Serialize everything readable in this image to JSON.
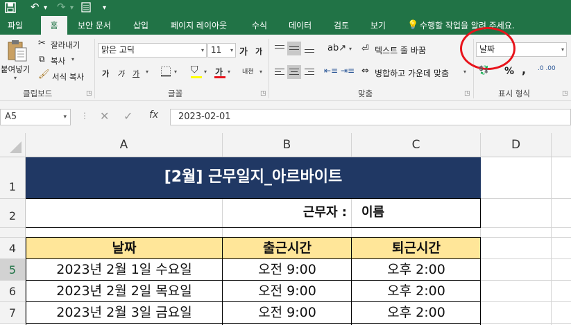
{
  "tabs": [
    "파일",
    "홈",
    "보안 문서",
    "삽입",
    "페이지 레이아웃",
    "수식",
    "데이터",
    "검토",
    "보기"
  ],
  "tell_me": "수행할 작업을 알려 주세요.",
  "clipboard": {
    "paste": "붙여넣기",
    "cut": "잘라내기",
    "copy": "복사",
    "format_painter": "서식 복사",
    "group": "클립보드"
  },
  "font": {
    "name": "맑은 고딕",
    "size": "11",
    "grow": "가",
    "shrink": "가",
    "bold": "가",
    "italic": "가",
    "underline": "가",
    "color_a": "가",
    "phonetic": "내천",
    "group": "글꼴"
  },
  "alignment": {
    "wrap": "텍스트 줄 바꿈",
    "merge": "병합하고 가운데 맞춤",
    "group": "맞춤"
  },
  "number": {
    "format": "날짜",
    "percent": "%",
    "comma": ",",
    "inc_dec": ".0 .00",
    "group": "표시 형식"
  },
  "name_box": "A5",
  "formula": "2023-02-01",
  "columns": [
    "A",
    "B",
    "C",
    "D"
  ],
  "rows": [
    "1",
    "2",
    "3",
    "4",
    "5",
    "6",
    "7"
  ],
  "sheet": {
    "title": "[2월] 근무일지_아르바이트",
    "worker_label": "근무자 :",
    "worker_name": "이름",
    "headers": [
      "날짜",
      "출근시간",
      "퇴근시간"
    ],
    "data": [
      [
        "2023년 2월 1일 수요일",
        "오전 9:00",
        "오후 2:00"
      ],
      [
        "2023년 2월 2일 목요일",
        "오전 9:00",
        "오후 2:00"
      ],
      [
        "2023년 2월 3일 금요일",
        "오전 9:00",
        "오후 2:00"
      ]
    ]
  },
  "colors": {
    "excel_green": "#217346",
    "title_fill": "#203864",
    "header_fill": "#FFE699",
    "highlight_circle": "#E8131B"
  }
}
